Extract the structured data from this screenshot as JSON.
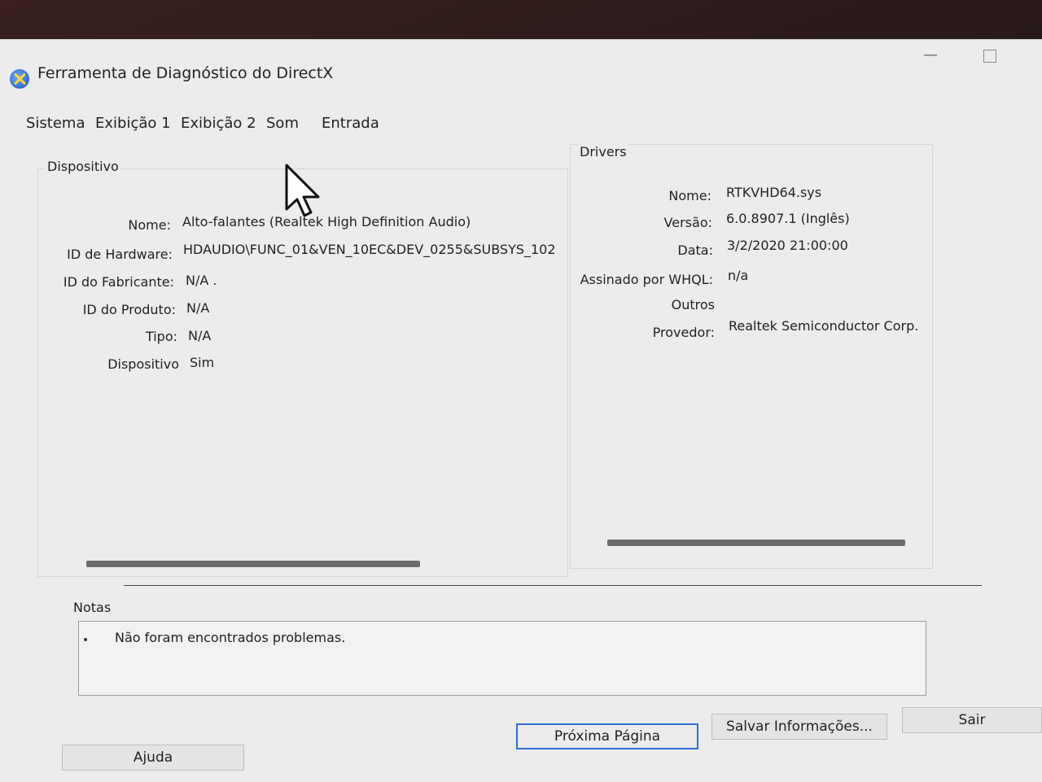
{
  "window": {
    "title": "Ferramenta de Diagnóstico do DirectX",
    "minimize_glyph": "—"
  },
  "tabs": [
    {
      "label": "Sistema"
    },
    {
      "label": "Exibição 1"
    },
    {
      "label": "Exibição 2"
    },
    {
      "label": "Som"
    },
    {
      "label": "Entrada"
    }
  ],
  "device": {
    "group_title": "Dispositivo",
    "fields": [
      {
        "label": "Nome:",
        "value": "Alto-falantes (Realtek High Definition Audio)"
      },
      {
        "label": "ID de Hardware:",
        "value": "HDAUDIO\\FUNC_01&VEN_10EC&DEV_0255&SUBSYS_102"
      },
      {
        "label": "ID do Fabricante:",
        "value": "N/A ."
      },
      {
        "label": "ID do Produto:",
        "value": "N/A"
      },
      {
        "label": "Tipo:",
        "value": "N/A"
      },
      {
        "label": "Dispositivo",
        "value": "Sim"
      }
    ]
  },
  "drivers": {
    "group_title": "Drivers",
    "fields": [
      {
        "label": "Nome:",
        "value": "RTKVHD64.sys"
      },
      {
        "label": "Versão:",
        "value": "6.0.8907.1 (Inglês)"
      },
      {
        "label": "Data:",
        "value": "3/2/2020 21:00:00"
      },
      {
        "label": "Assinado por WHQL:",
        "value": "n/a"
      },
      {
        "label": "Outros",
        "value": ""
      },
      {
        "label": "Provedor:",
        "value": "Realtek Semiconductor Corp."
      }
    ]
  },
  "notes": {
    "title": "Notas",
    "items": [
      "Não foram encontrados problemas."
    ]
  },
  "buttons": {
    "help": "Ajuda",
    "next_page": "Próxima Página",
    "save_info": "Salvar Informações...",
    "exit": "Sair"
  },
  "colors": {
    "accent": "#2f6fd6",
    "window_bg": "#ececec"
  }
}
